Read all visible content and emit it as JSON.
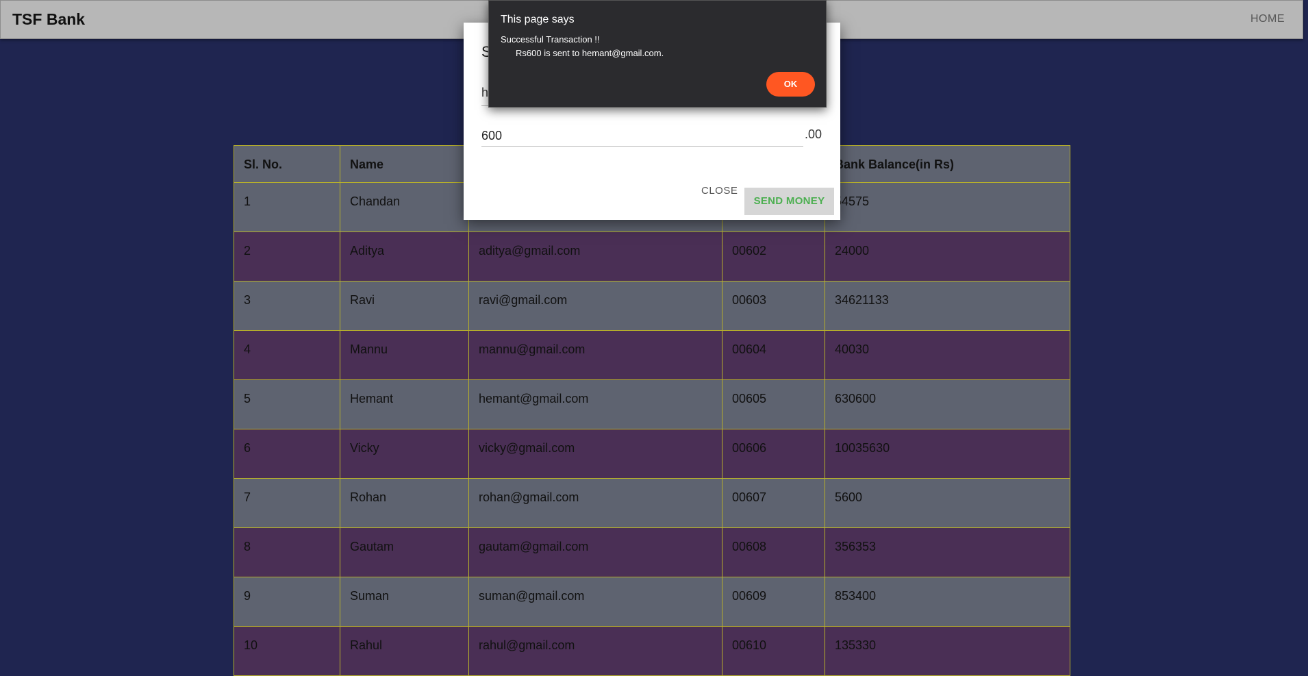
{
  "navbar": {
    "brand": "TSF Bank",
    "home": "HOME"
  },
  "table": {
    "headers": [
      "Sl. No.",
      "Name",
      "",
      "",
      "Bank Balance(in Rs)"
    ],
    "rows": [
      [
        "1",
        "Chandan",
        "",
        "",
        "54575"
      ],
      [
        "2",
        "Aditya",
        "aditya@gmail.com",
        "00602",
        "24000"
      ],
      [
        "3",
        "Ravi",
        "ravi@gmail.com",
        "00603",
        "34621133"
      ],
      [
        "4",
        "Mannu",
        "mannu@gmail.com",
        "00604",
        "40030"
      ],
      [
        "5",
        "Hemant",
        "hemant@gmail.com",
        "00605",
        "630600"
      ],
      [
        "6",
        "Vicky",
        "vicky@gmail.com",
        "00606",
        "10035630"
      ],
      [
        "7",
        "Rohan",
        "rohan@gmail.com",
        "00607",
        "5600"
      ],
      [
        "8",
        "Gautam",
        "gautam@gmail.com",
        "00608",
        "356353"
      ],
      [
        "9",
        "Suman",
        "suman@gmail.com",
        "00609",
        "853400"
      ],
      [
        "10",
        "Rahul",
        "rahul@gmail.com",
        "00610",
        "135330"
      ]
    ]
  },
  "modal": {
    "title_fragment": "S",
    "recipient_fragment": "h",
    "amount_value": "600",
    "amount_suffix": ".00",
    "close_label": "CLOSE",
    "send_label": "SEND MONEY"
  },
  "alert": {
    "title": "This page says",
    "line1": "Successful Transaction !!",
    "line2": "Rs600 is sent to hemant@gmail.com.",
    "ok_label": "OK"
  },
  "colors": {
    "background": "#1f2550",
    "row_gray": "#5e6370",
    "row_purple": "#4a2f55",
    "ok_button": "#ff5722",
    "send_text": "#4caf50"
  }
}
